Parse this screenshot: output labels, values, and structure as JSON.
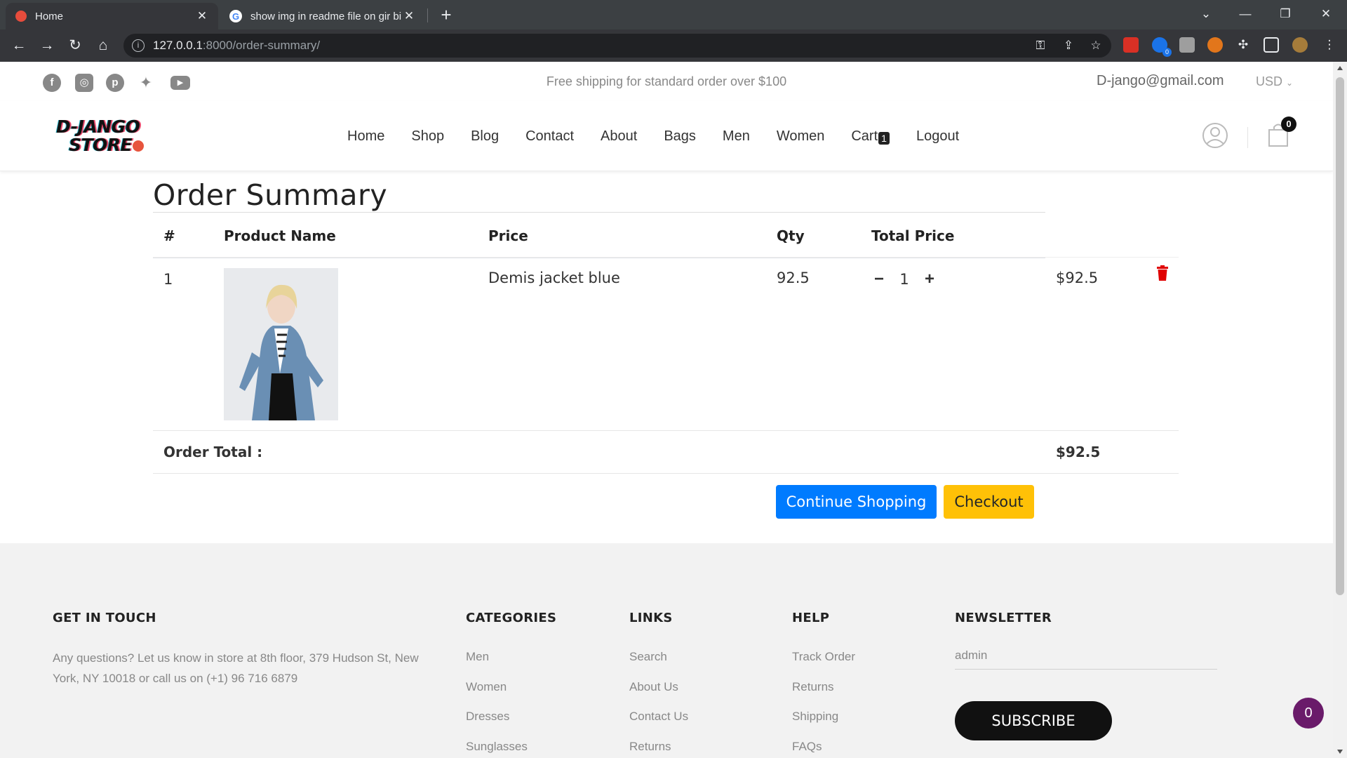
{
  "browser": {
    "tabs": [
      {
        "title": "Home",
        "close": "✕"
      },
      {
        "title": "show img in readme file on gir bi",
        "close": "✕"
      }
    ],
    "new_tab": "+",
    "url_host": "127.0.0.1",
    "url_path": ":8000/order-summary/",
    "ext_badge": "0"
  },
  "topbar": {
    "social": [
      "facebook-icon",
      "instagram-icon",
      "pinterest-icon",
      "twitter-icon",
      "youtube-icon"
    ],
    "shipping_text": "Free shipping for standard order over $100",
    "email": "D-jango@gmail.com",
    "currency": "USD"
  },
  "header": {
    "logo_line1": "D-JANGO",
    "logo_line2": "STORE",
    "menu": [
      "Home",
      "Shop",
      "Blog",
      "Contact",
      "About",
      "Bags",
      "Men",
      "Women",
      "Cart",
      "Logout"
    ],
    "cart_count": "1",
    "bag_count": "0"
  },
  "order": {
    "title": "Order Summary",
    "columns": [
      "#",
      "Product Name",
      "Price",
      "Qty",
      "Total Price"
    ],
    "items": [
      {
        "index": "1",
        "name": "Demis jacket blue",
        "price": "92.5",
        "qty": "1",
        "total": "$92.5"
      }
    ],
    "total_label": "Order Total :",
    "total_value": "$92.5",
    "continue_label": "Continue Shopping",
    "checkout_label": "Checkout"
  },
  "footer": {
    "get_in_touch": {
      "heading": "GET IN TOUCH",
      "text": "Any questions? Let us know in store at 8th floor, 379 Hudson St, New York, NY 10018 or call us on (+1) 96 716 6879"
    },
    "categories": {
      "heading": "CATEGORIES",
      "items": [
        "Men",
        "Women",
        "Dresses",
        "Sunglasses"
      ]
    },
    "links": {
      "heading": "LINKS",
      "items": [
        "Search",
        "About Us",
        "Contact Us",
        "Returns"
      ]
    },
    "help": {
      "heading": "HELP",
      "items": [
        "Track Order",
        "Returns",
        "Shipping",
        "FAQs"
      ]
    },
    "newsletter": {
      "heading": "NEWSLETTER",
      "input_value": "admin",
      "button": "SUBSCRIBE"
    }
  },
  "float_badge": "0",
  "colors": {
    "primary": "#007bff",
    "warning": "#ffc107",
    "danger": "#e00000",
    "chrome": "#35363a"
  }
}
